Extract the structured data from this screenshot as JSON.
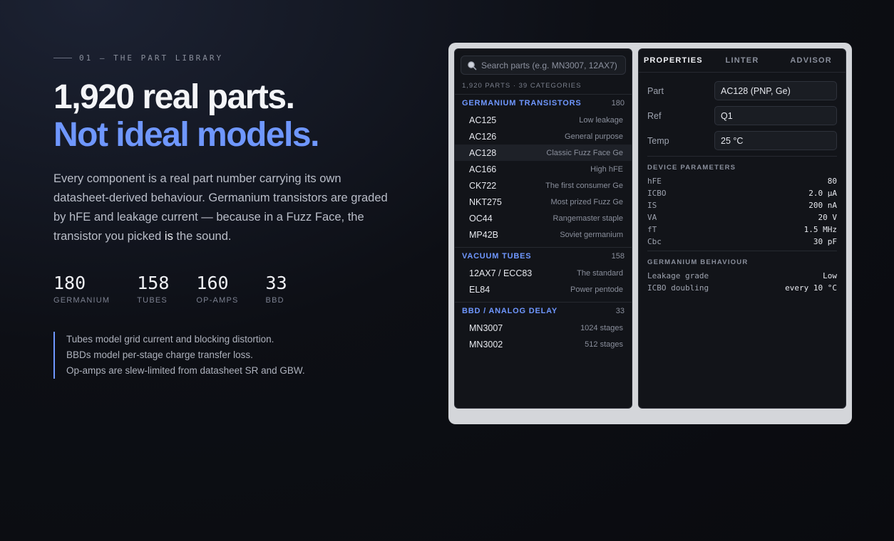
{
  "eyebrow": "01 — THE PART LIBRARY",
  "headline": {
    "line1": "1,920 real parts.",
    "line2": "Not ideal models."
  },
  "lede": {
    "part1": "Every component is a real part number carrying its own datasheet-derived behaviour. Germanium transistors are graded by hFE and leakage current — because in a Fuzz Face, the transistor you picked ",
    "emph": "is",
    "part2": " the sound."
  },
  "stats": [
    {
      "num": "180",
      "label": "GERMANIUM"
    },
    {
      "num": "158",
      "label": "TUBES"
    },
    {
      "num": "160",
      "label": "OP-AMPS"
    },
    {
      "num": "33",
      "label": "BBD"
    }
  ],
  "notes": [
    "Tubes model grid current and blocking distortion.",
    "BBDs model per-stage charge transfer loss.",
    "Op-amps are slew-limited from datasheet SR and GBW."
  ],
  "library": {
    "search_placeholder": "Search parts (e.g. MN3007, 12AX7)",
    "count": "1,920 PARTS · 39 CATEGORIES",
    "categories": [
      {
        "name": "GERMANIUM TRANSISTORS",
        "count": "180",
        "items": [
          {
            "pn": "AC125",
            "desc": "Low leakage"
          },
          {
            "pn": "AC126",
            "desc": "General purpose"
          },
          {
            "pn": "AC128",
            "desc": "Classic Fuzz Face Ge"
          },
          {
            "pn": "AC166",
            "desc": "High hFE"
          },
          {
            "pn": "CK722",
            "desc": "The first consumer Ge"
          },
          {
            "pn": "NKT275",
            "desc": "Most prized Fuzz Ge"
          },
          {
            "pn": "OC44",
            "desc": "Rangemaster staple"
          },
          {
            "pn": "MP42B",
            "desc": "Soviet germanium"
          }
        ]
      },
      {
        "name": "VACUUM TUBES",
        "count": "158",
        "items": [
          {
            "pn": "12AX7 / ECC83",
            "desc": "The standard"
          },
          {
            "pn": "EL84",
            "desc": "Power pentode"
          }
        ]
      },
      {
        "name": "BBD / ANALOG DELAY",
        "count": "33",
        "items": [
          {
            "pn": "MN3007",
            "desc": "1024 stages"
          },
          {
            "pn": "MN3002",
            "desc": "512 stages"
          }
        ]
      }
    ]
  },
  "props": {
    "tabs": [
      "PROPERTIES",
      "LINTER",
      "ADVISOR"
    ],
    "fields": [
      {
        "label": "Part",
        "value": "AC128 (PNP, Ge)"
      },
      {
        "label": "Ref",
        "value": "Q1"
      },
      {
        "label": "Temp",
        "value": "25 °C"
      }
    ],
    "device_title": "DEVICE PARAMETERS",
    "device": [
      {
        "k": "hFE",
        "v": "80"
      },
      {
        "k": "ICBO",
        "v": "2.0 µA"
      },
      {
        "k": "IS",
        "v": "200 nA"
      },
      {
        "k": "VA",
        "v": "20 V"
      },
      {
        "k": "fT",
        "v": "1.5 MHz"
      },
      {
        "k": "Cbc",
        "v": "30 pF"
      }
    ],
    "ge_title": "GERMANIUM BEHAVIOUR",
    "ge": [
      {
        "k": "Leakage grade",
        "v": "Low"
      },
      {
        "k": "ICBO doubling",
        "v": "every 10 °C"
      }
    ]
  }
}
